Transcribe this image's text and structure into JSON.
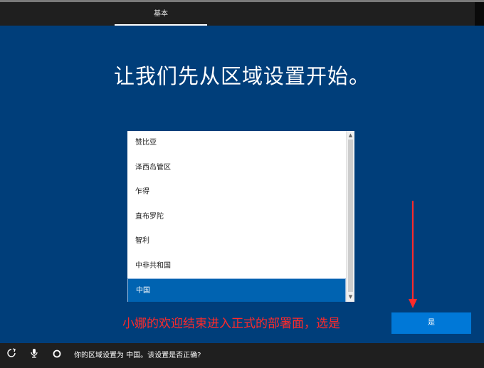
{
  "header": {
    "tab_label": "基本"
  },
  "main": {
    "title": "让我们先从区域设置开始。"
  },
  "region_list": {
    "items": [
      "赞比亚",
      "泽西岛管区",
      "乍得",
      "直布罗陀",
      "智利",
      "中非共和国",
      "中国"
    ],
    "selected": "中国"
  },
  "annotation": {
    "text": "小娜的欢迎结束进入正式的部署面，选是"
  },
  "yes_button": {
    "label": "是"
  },
  "taskbar": {
    "status_text": "你的区域设置为 中国。该设置是否正确?",
    "icons": [
      "accessibility-icon",
      "microphone-icon",
      "cortana-circle-icon"
    ]
  },
  "colors": {
    "background": "#003e7a",
    "accent": "#0078d7",
    "selected": "#0063b1",
    "annotation": "#ff2a2a",
    "bar": "#1f1f1f"
  }
}
